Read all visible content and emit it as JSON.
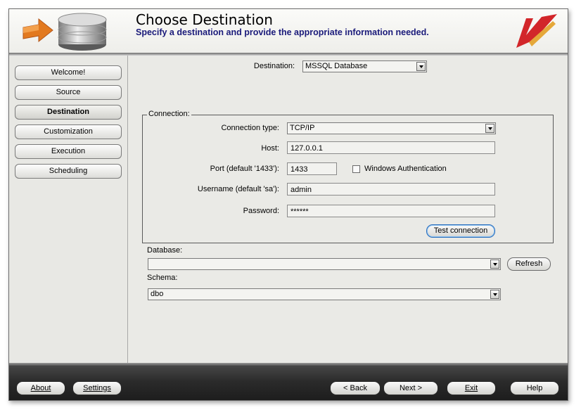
{
  "header": {
    "title": "Choose Destination",
    "subtitle": "Specify a destination and provide the appropriate information needed."
  },
  "sidebar": {
    "items": [
      {
        "label": "Welcome!"
      },
      {
        "label": "Source"
      },
      {
        "label": "Destination",
        "active": true
      },
      {
        "label": "Customization"
      },
      {
        "label": "Execution"
      },
      {
        "label": "Scheduling"
      }
    ]
  },
  "destination": {
    "label": "Destination:",
    "value": "MSSQL Database"
  },
  "connection": {
    "group_label": "Connection:",
    "type_label": "Connection type:",
    "type_value": "TCP/IP",
    "host_label": "Host:",
    "host_value": "127.0.0.1",
    "port_label": "Port (default '1433'):",
    "port_value": "1433",
    "windows_auth_label": "Windows Authentication",
    "windows_auth_checked": false,
    "username_label": "Username (default 'sa'):",
    "username_value": "admin",
    "password_label": "Password:",
    "password_value": "******",
    "test_button": "Test connection"
  },
  "database": {
    "label": "Database:",
    "value": "",
    "refresh_button": "Refresh"
  },
  "schema": {
    "label": "Schema:",
    "value": "dbo"
  },
  "footer": {
    "about": "About",
    "settings": "Settings",
    "back": "< Back",
    "next": "Next >",
    "exit": "Exit",
    "help": "Help"
  },
  "icons": {
    "header_left": "database-import-icon",
    "header_right": "brand-logo-icon"
  },
  "colors": {
    "subtitle": "#1a1a7a",
    "logo_red": "#d2262a",
    "arrow_orange": "#e2791f",
    "footer_bg": "#2b2b2b"
  }
}
